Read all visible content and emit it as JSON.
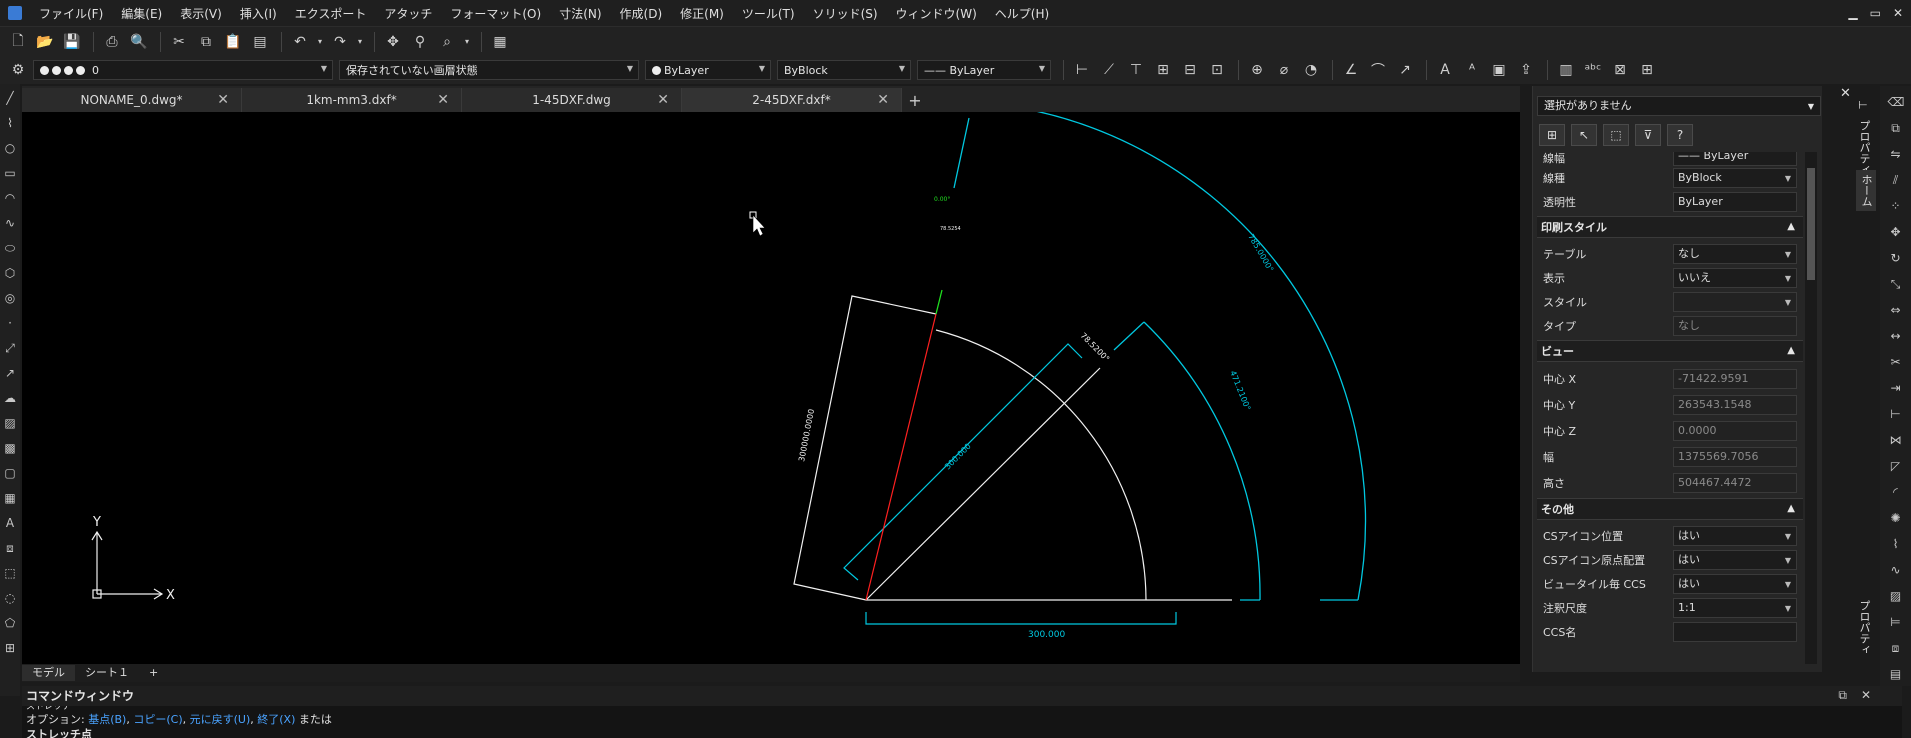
{
  "menubar": {
    "items": [
      "ファイル(F)",
      "編集(E)",
      "表示(V)",
      "挿入(I)",
      "エクスポート",
      "アタッチ",
      "フォーマット(O)",
      "寸法(N)",
      "作成(D)",
      "修正(M)",
      "ツール(T)",
      "ソリッド(S)",
      "ウィンドウ(W)",
      "ヘルプ(H)"
    ],
    "window_controls": [
      "▁",
      "▭",
      "✕"
    ]
  },
  "toolbar2": {
    "layer_value": "0",
    "layer_state": "保存されていない画層状態",
    "color": "ByLayer",
    "linetype": "ByBlock",
    "lineweight": "—— ByLayer"
  },
  "tabs": [
    {
      "label": "NONAME_0.dwg*",
      "active": false
    },
    {
      "label": "1km-mm3.dxf*",
      "active": false
    },
    {
      "label": "1-45DXF.dwg",
      "active": false
    },
    {
      "label": "2-45DXF.dxf*",
      "active": true
    }
  ],
  "tab_add": "+",
  "drawing": {
    "ucs_y": "Y",
    "ucs_x": "X",
    "dim_bottom": "300.000",
    "dim_diag_cyan": "300.000",
    "dim_left_white": "300000.0000",
    "dim_arc_white": "78.5200°",
    "dim_arc_mid_cyan": "471.2100°",
    "dim_arc_outer_cyan": "785.0000°",
    "dim_green_top": "0.00°",
    "dim_green_small": "78.5254"
  },
  "layout_tabs": [
    "モデル",
    "シート１"
  ],
  "layout_add": "+",
  "command": {
    "title": "コマンドウィンドウ",
    "line0": "ストレッチ",
    "option_prefix": "オプション: ",
    "options": [
      "基点(B)",
      "コピー(C)",
      "元に戻す(U)",
      "終了(X)"
    ],
    "option_suffix": "または",
    "line2": "ストレッチ点"
  },
  "properties": {
    "selection": "選択がありません",
    "rows_top": [
      {
        "key": "線幅",
        "value": "—— ByLayer",
        "dropdown": true
      },
      {
        "key": "線種",
        "value": "ByBlock",
        "dropdown": true
      },
      {
        "key": "透明性",
        "value": "ByLayer",
        "dropdown": false
      }
    ],
    "print_style": {
      "header": "印刷スタイル",
      "rows": [
        {
          "key": "テーブル",
          "value": "なし",
          "dropdown": true
        },
        {
          "key": "表示",
          "value": "いいえ",
          "dropdown": true
        },
        {
          "key": "スタイル",
          "value": "",
          "dropdown": true
        },
        {
          "key": "タイプ",
          "value": "なし",
          "dropdown": false
        }
      ]
    },
    "view": {
      "header": "ビュー",
      "rows": [
        {
          "key": "中心 X",
          "value": "-71422.9591"
        },
        {
          "key": "中心 Y",
          "value": "263543.1548"
        },
        {
          "key": "中心 Z",
          "value": "0.0000"
        },
        {
          "key": "幅",
          "value": "1375569.7056"
        },
        {
          "key": "高さ",
          "value": "504467.4472"
        }
      ]
    },
    "misc": {
      "header": "その他",
      "rows": [
        {
          "key": "CSアイコン位置",
          "value": "はい"
        },
        {
          "key": "CSアイコン原点配置",
          "value": "はい"
        },
        {
          "key": "ビュータイル毎 CCS",
          "value": "はい"
        },
        {
          "key": "注釈尺度",
          "value": "1:1"
        },
        {
          "key": "CCS名",
          "value": ""
        }
      ]
    }
  },
  "vertical_tabs": {
    "properties": "プロパティ",
    "home": "ホーム",
    "properties_bottom": "プロパティ"
  },
  "colors": {
    "canvas": "#000000",
    "cyan": "#00c8e0",
    "white": "#f0f0f0",
    "red": "#ff2020",
    "green": "#20e020",
    "link": "#4aa3ff"
  }
}
